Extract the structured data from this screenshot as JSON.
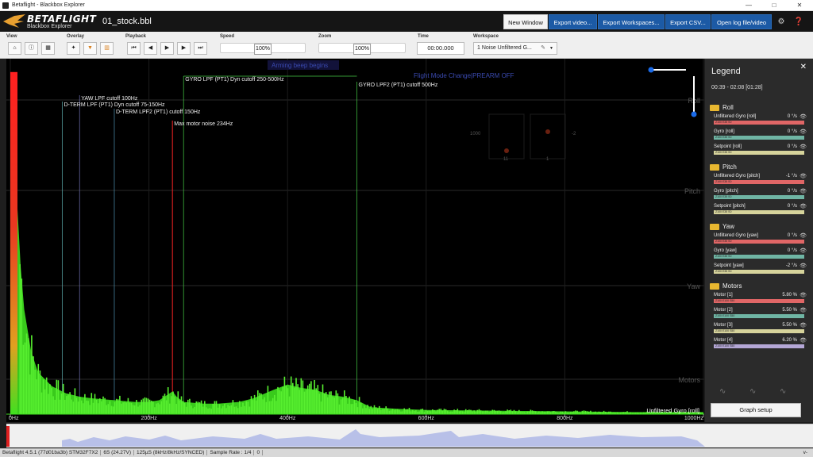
{
  "window": {
    "title": "Betaflight - Blackbox Explorer"
  },
  "header": {
    "brand": "BETAFLIGHT",
    "brand_sub": "Blackbox Explorer",
    "filename": "01_stock.bbl",
    "buttons": [
      "New Window",
      "Export video...",
      "Export Workspaces...",
      "Export CSV...",
      "Open log file/video"
    ]
  },
  "toolbar": {
    "view_label": "View",
    "overlay_label": "Overlay",
    "playback_label": "Playback",
    "speed_label": "Speed",
    "speed_value": "100%",
    "zoom_label": "Zoom",
    "zoom_value": "100%",
    "time_label": "Time",
    "time_value": "00:00.000",
    "workspace_label": "Workspace",
    "workspace_value": "1 Noise Unfiltered G..."
  },
  "graph": {
    "annotations": [
      {
        "text": "YAW LPF cutoff 100Hz"
      },
      {
        "text": "D-TERM LPF (PT1) Dyn cutoff 75-150Hz"
      },
      {
        "text": "D-TERM LPF2 (PT1) cutoff 150Hz"
      },
      {
        "text": "Max motor noise 234Hz"
      },
      {
        "text": "GYRO LPF (PT1) Dyn cutoff 250-500Hz"
      },
      {
        "text": "GYRO LPF2 (PT1) cutoff 500Hz"
      }
    ],
    "events": [
      "Arming beep begins",
      "Flight Mode Change|PREARM OFF"
    ],
    "axis_labels": [
      "Roll",
      "Pitch",
      "Yaw",
      "Motors"
    ],
    "x_ticks": [
      "0Hz",
      "200Hz",
      "400Hz",
      "600Hz",
      "800Hz",
      "1000Hz"
    ],
    "trace_label": "Unfiltered Gyro [roll]",
    "stick_overlay": [
      "1000",
      "-2",
      "11",
      "1"
    ]
  },
  "chart_data": {
    "type": "area",
    "title": "",
    "xlabel": "",
    "ylabel": "",
    "x_ticks": [
      "0Hz",
      "200Hz",
      "400Hz",
      "600Hz",
      "800Hz",
      "1000Hz"
    ],
    "xlim": [
      0,
      1000
    ],
    "ylim": [
      0,
      1
    ],
    "series": [
      {
        "name": "Unfiltered Gyro [roll]",
        "x": [
          0,
          5,
          10,
          15,
          20,
          30,
          40,
          60,
          80,
          100,
          120,
          150,
          180,
          200,
          215,
          230,
          234,
          240,
          250,
          280,
          300,
          330,
          350,
          380,
          400,
          420,
          440,
          460,
          480,
          500,
          520,
          560,
          600,
          700,
          800,
          900,
          1000
        ],
        "y": [
          0.98,
          0.9,
          0.6,
          0.42,
          0.3,
          0.18,
          0.12,
          0.08,
          0.06,
          0.05,
          0.045,
          0.04,
          0.035,
          0.035,
          0.04,
          0.06,
          0.065,
          0.05,
          0.035,
          0.03,
          0.03,
          0.035,
          0.045,
          0.07,
          0.085,
          0.075,
          0.07,
          0.055,
          0.05,
          0.04,
          0.02,
          0.015,
          0.012,
          0.01,
          0.008,
          0.006,
          0.006
        ]
      }
    ],
    "markers": [
      {
        "label": "YAW LPF cutoff 100Hz",
        "x": 100
      },
      {
        "label": "D-TERM LPF (PT1) Dyn cutoff 75-150Hz",
        "x": 75
      },
      {
        "label": "D-TERM LPF2 (PT1) cutoff 150Hz",
        "x": 150
      },
      {
        "label": "Max motor noise 234Hz",
        "x": 234
      },
      {
        "label": "GYRO LPF (PT1) Dyn cutoff 250-500Hz",
        "x": 250
      },
      {
        "label": "GYRO LPF2 (PT1) cutoff 500Hz",
        "x": 500
      }
    ]
  },
  "legend": {
    "title": "Legend",
    "range": "00:39 - 02:08 [01:28]",
    "groups": [
      {
        "name": "Roll",
        "fields": [
          {
            "name": "Unfiltered Gyro [roll]",
            "value": "0 °/s",
            "scale": "Z100 E35 S0",
            "color": "#e06666"
          },
          {
            "name": "Gyro [roll]",
            "value": "0 °/s",
            "scale": "Z100 E35 S0",
            "color": "#6fb5a4"
          },
          {
            "name": "Setpoint [roll]",
            "value": "0 °/s",
            "scale": "Z100 E35 S0",
            "color": "#d6d39b"
          }
        ]
      },
      {
        "name": "Pitch",
        "fields": [
          {
            "name": "Unfiltered Gyro [pitch]",
            "value": "-1 °/s",
            "scale": "Z100 E35 S0",
            "color": "#e06666"
          },
          {
            "name": "Gyro [pitch]",
            "value": "0 °/s",
            "scale": "Z100 E35 S0",
            "color": "#6fb5a4"
          },
          {
            "name": "Setpoint [pitch]",
            "value": "0 °/s",
            "scale": "Z100 E35 S0",
            "color": "#d6d39b"
          }
        ]
      },
      {
        "name": "Yaw",
        "fields": [
          {
            "name": "Unfiltered Gyro [yaw]",
            "value": "0 °/s",
            "scale": "Z100 E35 S0",
            "color": "#e06666"
          },
          {
            "name": "Gyro [yaw]",
            "value": "0 °/s",
            "scale": "Z100 E35 S0",
            "color": "#6fb5a4"
          },
          {
            "name": "Setpoint [yaw]",
            "value": "-2 °/s",
            "scale": "Z100 E35 S0",
            "color": "#d6d39b"
          }
        ]
      },
      {
        "name": "Motors",
        "fields": [
          {
            "name": "Motor [1]",
            "value": "5.80 %",
            "scale": "Z100 E100 S50",
            "color": "#e06666"
          },
          {
            "name": "Motor [2]",
            "value": "5.50 %",
            "scale": "Z100 E100 S50",
            "color": "#6fb5a4"
          },
          {
            "name": "Motor [3]",
            "value": "5.50 %",
            "scale": "Z100 E100 S50",
            "color": "#d6d39b"
          },
          {
            "name": "Motor [4]",
            "value": "6.20 %",
            "scale": "Z100 E100 S50",
            "color": "#b4a7d6"
          }
        ]
      }
    ],
    "graph_setup_label": "Graph setup"
  },
  "statusbar": {
    "items": [
      "Betaflight 4.5.1 (77d01ba3b) STM32F7X2",
      "6S (24.27V)",
      "125µS (8kHz/8kHz/SYNCED)",
      "Sample Rate : 1/4",
      "0"
    ],
    "version": "v-"
  },
  "colors": {
    "accent": "#1c5aa5",
    "spectrum": "#3fe01f",
    "marker_red": "#e02020"
  }
}
